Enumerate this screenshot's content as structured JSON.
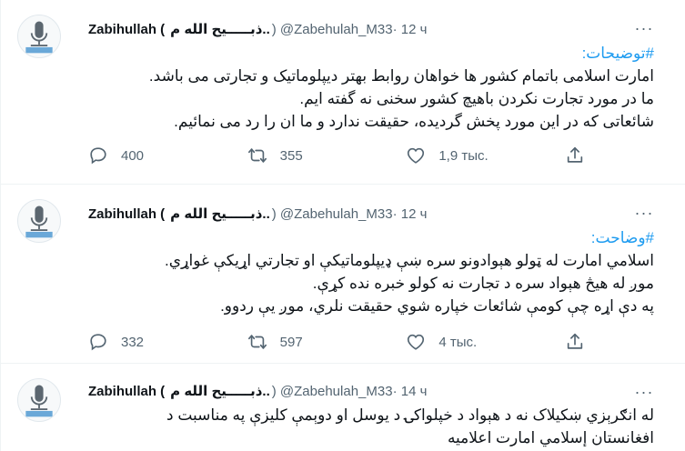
{
  "tweets": [
    {
      "author_name": "Zabihullah (",
      "author_name_rtl": "ذبـــــیح الله م..",
      "handle": ") @Zabehulah_M33",
      "time": "· 12 ч",
      "hashtag": "#توضیحات:",
      "lines": [
        "امارت اسلامی باتمام کشور ها خواهان روابط بهتر دیپلوماتیک و تجارتی می باشد.",
        "ما در مورد تجارت نکردن باهیچ کشور سخنی نه گفته ایم.",
        "شائعاتی که در این مورد پخش گردیده، حقیقت ندارد و ما ان را رد می نمائیم."
      ],
      "replies": "400",
      "retweets": "355",
      "likes": "1,9 тыс."
    },
    {
      "author_name": "Zabihullah (",
      "author_name_rtl": "ذبـــــیح الله م..",
      "handle": ") @Zabehulah_M33",
      "time": "· 12 ч",
      "hashtag": "#وضاحت:",
      "lines": [
        "اسلامي امارت له ټولو هېوادونو سره ښې ډیپلوماتیکې او تجارتي اړیکې غواړي.",
        "موږ له هیڅ هېواد سره د تجارت نه کولو خبره نده کړې.",
        "په دې اړه چې کومې شائعات خپاره شوي حقیقت نلري، موږ یې ردوو."
      ],
      "replies": "332",
      "retweets": "597",
      "likes": "4 тыс."
    },
    {
      "author_name": "Zabihullah (",
      "author_name_rtl": "ذبـــــیح الله م..",
      "handle": ") @Zabehulah_M33",
      "time": "· 14 ч",
      "lines": [
        "له انګرېزي ښکيلاک نه د هېواد د خپلواکۍ د یوسل او دوېمې کلیزې په مناسبت د",
        "افغانستان إسلامي امارت اعلامیه"
      ]
    }
  ],
  "icons": {
    "more": "more-horizontal-icon",
    "reply": "reply-icon",
    "retweet": "retweet-icon",
    "like": "heart-icon",
    "share": "share-icon"
  },
  "colors": {
    "hashtag": "#1d9bf0",
    "secondary_text": "#536471",
    "divider": "#eff3f4"
  }
}
